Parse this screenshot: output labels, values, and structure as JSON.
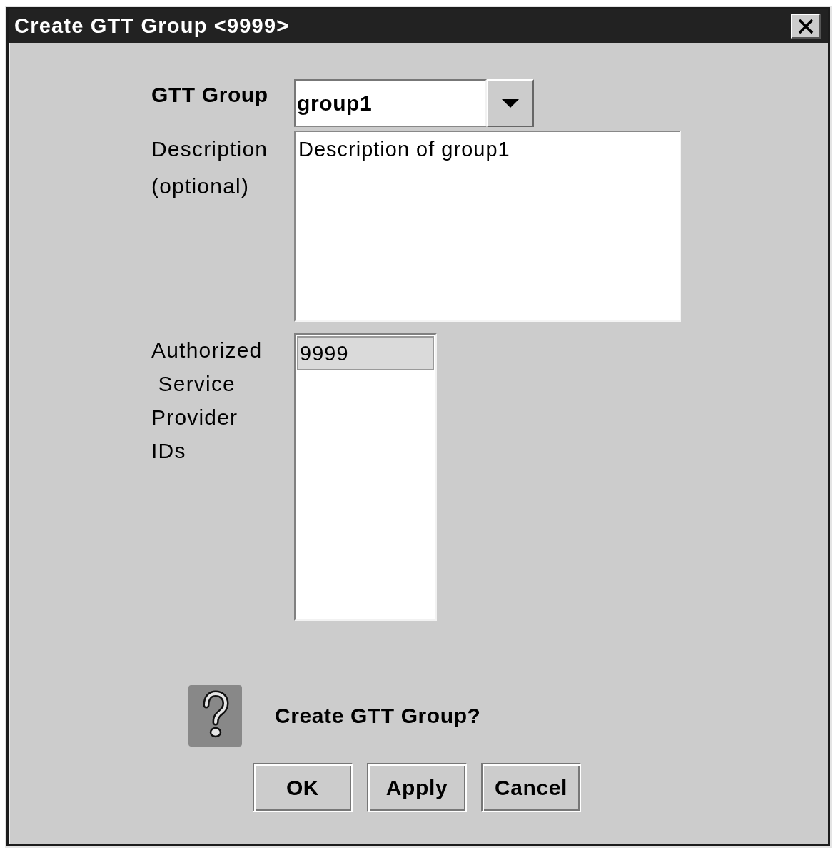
{
  "window": {
    "title": "Create GTT Group <9999>"
  },
  "form": {
    "gtt_group": {
      "label": "GTT Group",
      "value": "group1"
    },
    "description": {
      "label_lines": [
        "Description",
        "(optional)"
      ],
      "value": "Description of group1"
    },
    "provider_ids": {
      "label_lines": [
        "Authorized",
        " Service",
        "Provider",
        "IDs"
      ],
      "items": [
        {
          "label": "9999",
          "selected": true
        }
      ]
    }
  },
  "prompt": {
    "text": "Create GTT Group?"
  },
  "buttons": [
    {
      "label": "OK"
    },
    {
      "label": "Apply"
    },
    {
      "label": "Cancel"
    }
  ]
}
